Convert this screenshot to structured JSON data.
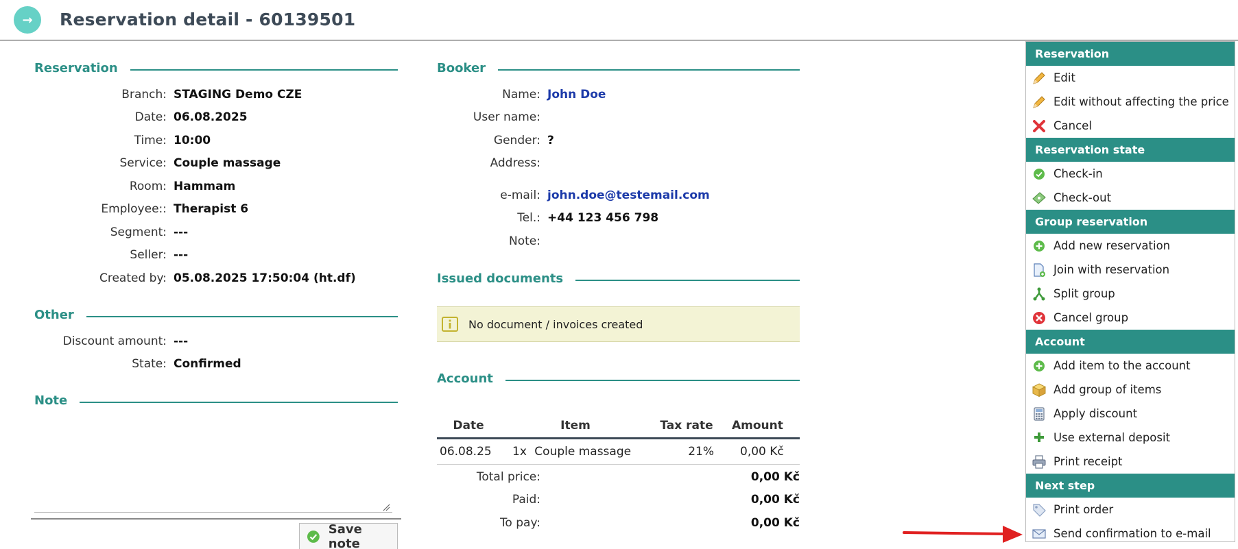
{
  "header": {
    "title": "Reservation detail - 60139501",
    "back_icon": "→"
  },
  "reservation": {
    "title": "Reservation",
    "rows": [
      {
        "label": "Branch:",
        "value": "STAGING Demo CZE"
      },
      {
        "label": "Date:",
        "value": "06.08.2025"
      },
      {
        "label": "Time:",
        "value": "10:00"
      },
      {
        "label": "Service:",
        "value": "Couple massage"
      },
      {
        "label": "Room:",
        "value": "Hammam"
      },
      {
        "label": "Employee::",
        "value": "Therapist 6"
      },
      {
        "label": "Segment:",
        "value": "---"
      },
      {
        "label": "Seller:",
        "value": "---"
      },
      {
        "label": "Created by:",
        "value": "05.08.2025 17:50:04 (ht.df)"
      }
    ]
  },
  "other": {
    "title": "Other",
    "rows": [
      {
        "label": "Discount amount:",
        "value": "---"
      },
      {
        "label": "State:",
        "value": "Confirmed"
      }
    ]
  },
  "note": {
    "title": "Note",
    "value": "",
    "save_label": "Save note"
  },
  "booker": {
    "title": "Booker",
    "rows": [
      {
        "label": "Name:",
        "value": "John Doe"
      },
      {
        "label": "User name:",
        "value": ""
      },
      {
        "label": "Gender:",
        "value": "?"
      },
      {
        "label": "Address:",
        "value": ""
      },
      {
        "label": "e-mail:",
        "value": "john.doe@testemail.com"
      },
      {
        "label": "Tel.:",
        "value": "+44 123 456 798"
      },
      {
        "label": "Note:",
        "value": ""
      }
    ]
  },
  "documents": {
    "title": "Issued documents",
    "message": "No document / invoices created"
  },
  "account": {
    "title": "Account",
    "columns": [
      "Date",
      "Item",
      "Tax rate",
      "Amount"
    ],
    "rows": [
      {
        "date": "06.08.25",
        "qty": "1x",
        "item": "Couple massage",
        "tax": "21%",
        "amount": "0,00 Kč"
      }
    ],
    "totals": [
      {
        "label": "Total price:",
        "value": "0,00 Kč"
      },
      {
        "label": "Paid:",
        "value": "0,00 Kč"
      },
      {
        "label": "To pay:",
        "value": "0,00 Kč"
      }
    ]
  },
  "panel": {
    "sections": [
      {
        "title": "Reservation",
        "items": [
          {
            "label": "Edit",
            "icon": "pencil-icon"
          },
          {
            "label": "Edit without affecting the price",
            "icon": "pencil-icon"
          },
          {
            "label": "Cancel",
            "icon": "red-x-icon"
          }
        ]
      },
      {
        "title": "Reservation state",
        "items": [
          {
            "label": "Check-in",
            "icon": "green-check-icon"
          },
          {
            "label": "Check-out",
            "icon": "ticket-icon"
          }
        ]
      },
      {
        "title": "Group reservation",
        "items": [
          {
            "label": "Add new reservation",
            "icon": "green-plus-circle-icon"
          },
          {
            "label": "Join with reservation",
            "icon": "document-add-icon"
          },
          {
            "label": "Split group",
            "icon": "split-icon"
          },
          {
            "label": "Cancel group",
            "icon": "red-x-circle-icon"
          }
        ]
      },
      {
        "title": "Account",
        "items": [
          {
            "label": "Add item to the account",
            "icon": "green-plus-circle-icon"
          },
          {
            "label": "Add group of items",
            "icon": "box-icon"
          },
          {
            "label": "Apply discount",
            "icon": "calculator-icon"
          },
          {
            "label": "Use external deposit",
            "icon": "plus-icon"
          },
          {
            "label": "Print receipt",
            "icon": "printer-icon"
          }
        ]
      },
      {
        "title": "Next step",
        "items": [
          {
            "label": "Print order",
            "icon": "tag-icon"
          },
          {
            "label": "Send confirmation to e-mail",
            "icon": "envelope-icon"
          }
        ]
      }
    ]
  },
  "colors": {
    "accent": "#2b8f86",
    "header_text": "#3d4a57",
    "link": "#1c3aa9",
    "info_bg": "#f3f3d5",
    "arrow": "#e02020"
  }
}
